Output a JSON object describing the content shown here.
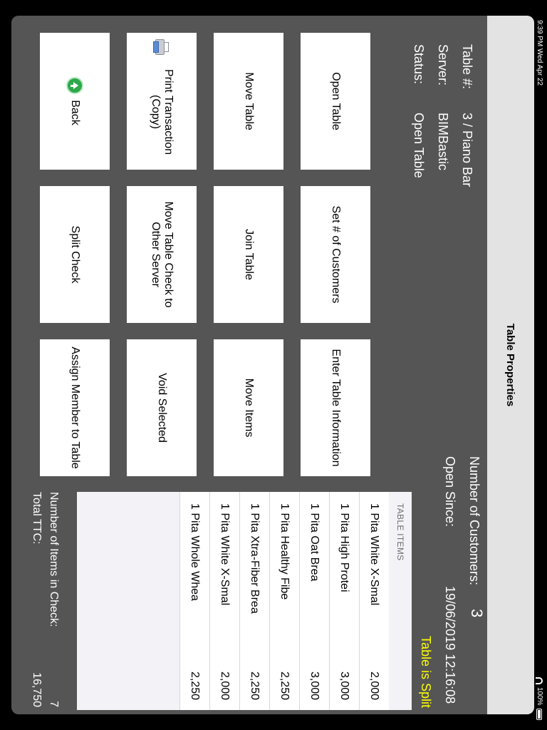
{
  "status_bar": {
    "time": "9:39 PM  Wed Apr 22",
    "battery": "100%"
  },
  "window": {
    "title": "Table Properties"
  },
  "table_info": {
    "table_label": "Table #:",
    "table_value": "3 / Piano Bar",
    "server_label": "Server:",
    "server_value": "BIMBastic",
    "status_label": "Status:",
    "status_value": "Open Table",
    "customers_label": "Number of Customers:",
    "customers_value": "3",
    "open_since_label": "Open Since:",
    "open_since_value": "19/06/2019 12:16:08",
    "split_notice": "Table is Split"
  },
  "buttons": {
    "open_table": "Open Table",
    "set_customers": "Set # of Customers",
    "enter_info": "Enter Table Information",
    "move_table": "Move Table",
    "join_table": "Join Table",
    "move_items": "Move Items",
    "print_copy": "Print Transaction (Copy)",
    "move_check": "Move Table Check to Other Server",
    "void_selected": "Void Selected",
    "back": "Back",
    "split_check": "Split Check",
    "assign_member": "Assign Member to Table"
  },
  "items": {
    "header": "TABLE ITEMS",
    "rows": [
      {
        "desc": "1 Pita White X-Smal",
        "price": "2,000"
      },
      {
        "desc": "1 Pita High Protei",
        "price": "3,000"
      },
      {
        "desc": "1 Pita Oat Brea",
        "price": "3,000"
      },
      {
        "desc": "1 Pita Healthy Fibe",
        "price": "2,250"
      },
      {
        "desc": "1 Pita Xtra-Fiber Brea",
        "price": "2,250"
      },
      {
        "desc": "1 Pita White X-Smal",
        "price": "2,000"
      },
      {
        "desc": "1 Pita Whole Whea",
        "price": "2,250"
      }
    ]
  },
  "totals": {
    "count_label": "Number of Items in Check:",
    "count_value": "7",
    "total_label": "Total TTC:",
    "total_value": "16,750"
  },
  "colors": {
    "background": "#555555",
    "accent_yellow": "#ffff00",
    "titlebar": "#e3e3e3"
  }
}
